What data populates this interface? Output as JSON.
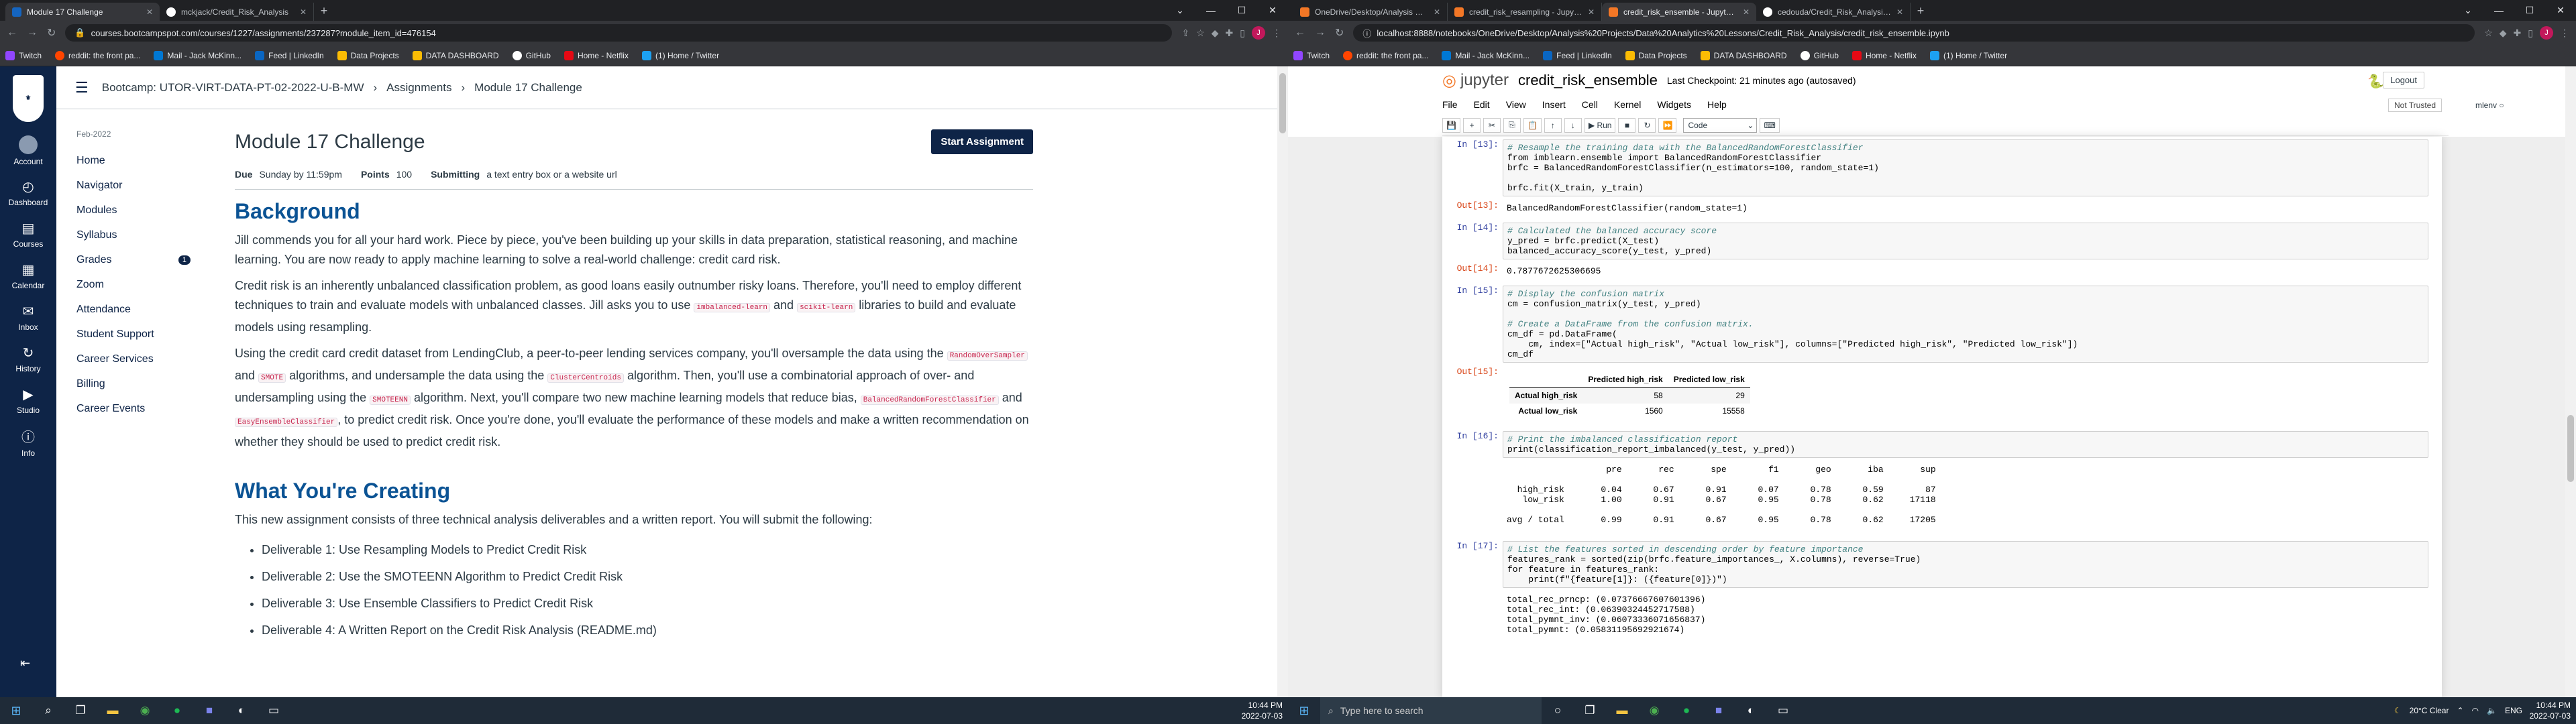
{
  "left": {
    "tabs": [
      {
        "title": "Module 17 Challenge",
        "active": true,
        "color": "#1565c0"
      },
      {
        "title": "mckjack/Credit_Risk_Analysis",
        "active": false,
        "color": "#ffffff"
      }
    ],
    "url": "courses.bootcampspot.com/courses/1227/assignments/237287?module_item_id=476154",
    "bookmarks": [
      "Twitch",
      "reddit: the front pa...",
      "Mail - Jack McKinn...",
      "Feed | LinkedIn",
      "Data Projects",
      "DATA DASHBOARD",
      "GitHub",
      "Home - Netflix",
      "(1) Home / Twitter"
    ],
    "global_nav": [
      {
        "label": "Account",
        "icon": "●",
        "selected": false
      },
      {
        "label": "Dashboard",
        "icon": "◴",
        "selected": false
      },
      {
        "label": "Courses",
        "icon": "▤",
        "selected": false
      },
      {
        "label": "Calendar",
        "icon": "▦",
        "selected": false
      },
      {
        "label": "Inbox",
        "icon": "✉",
        "selected": false
      },
      {
        "label": "History",
        "icon": "↻",
        "selected": false
      },
      {
        "label": "Studio",
        "icon": "▶",
        "selected": false
      },
      {
        "label": "Info",
        "icon": "ⓘ",
        "selected": false
      }
    ],
    "breadcrumb": [
      "Bootcamp: UTOR-VIRT-DATA-PT-02-2022-U-B-MW",
      "Assignments",
      "Module 17 Challenge"
    ],
    "course_term": "Feb-2022",
    "course_nav": [
      {
        "label": "Home",
        "badge": ""
      },
      {
        "label": "Navigator",
        "badge": ""
      },
      {
        "label": "Modules",
        "badge": ""
      },
      {
        "label": "Syllabus",
        "badge": ""
      },
      {
        "label": "Grades",
        "badge": "1"
      },
      {
        "label": "Zoom",
        "badge": ""
      },
      {
        "label": "Attendance",
        "badge": ""
      },
      {
        "label": "Student Support",
        "badge": ""
      },
      {
        "label": "Career Services",
        "badge": ""
      },
      {
        "label": "Billing",
        "badge": ""
      },
      {
        "label": "Career Events",
        "badge": ""
      }
    ],
    "page_title": "Module 17 Challenge",
    "start_button": "Start Assignment",
    "meta": {
      "due_label": "Due",
      "due_value": "Sunday by 11:59pm",
      "points_label": "Points",
      "points_value": "100",
      "submitting_label": "Submitting",
      "submitting_value": "a text entry box or a website url"
    },
    "section1_title": "Background",
    "p1": "Jill commends you for all your hard work. Piece by piece, you've been building up your skills in data preparation, statistical reasoning, and machine learning. You are now ready to apply machine learning to solve a real-world challenge: credit card risk.",
    "p2a": "Credit risk is an inherently unbalanced classification problem, as good loans easily outnumber risky loans. Therefore, you'll need to employ different techniques to train and evaluate models with unbalanced classes. Jill asks you to use ",
    "p2_code1": "imbalanced-learn",
    "p2b": " and ",
    "p2_code2": "scikit-learn",
    "p2c": " libraries to build and evaluate models using resampling.",
    "p3a": "Using the credit card credit dataset from LendingClub, a peer-to-peer lending services company, you'll oversample the data using the ",
    "p3_code1": "RandomOverSampler",
    "p3b": " and ",
    "p3_code2": "SMOTE",
    "p3c": " algorithms, and undersample the data using the ",
    "p3_code3": "ClusterCentroids",
    "p3d": " algorithm. Then, you'll use a combinatorial approach of over- and undersampling using the ",
    "p3_code4": "SMOTEENN",
    "p3e": " algorithm. Next, you'll compare two new machine learning models that reduce bias, ",
    "p3_code5": "BalancedRandomForestClassifier",
    "p3f": " and ",
    "p3_code6": "EasyEnsembleClassifier",
    "p3g": ", to predict credit risk. Once you're done, you'll evaluate the performance of these models and make a written recommendation on whether they should be used to predict credit risk.",
    "section2_title": "What You're Creating",
    "p4": "This new assignment consists of three technical analysis deliverables and a written report. You will submit the following:",
    "deliverables": [
      "Deliverable 1: Use Resampling Models to Predict Credit Risk",
      "Deliverable 2: Use the SMOTEENN Algorithm to Predict Credit Risk",
      "Deliverable 3: Use Ensemble Classifiers to Predict Credit Risk",
      "Deliverable 4: A Written Report on the Credit Risk Analysis (README.md)"
    ],
    "taskbar": {
      "search_placeholder": "Type here to search",
      "time": "10:44 PM",
      "date": "2022-07-03"
    }
  },
  "right": {
    "tabs": [
      {
        "title": "OneDrive/Desktop/Analysis Proj...",
        "active": false,
        "color": "#f37726"
      },
      {
        "title": "credit_risk_resampling - Jupyter N...",
        "active": false,
        "color": "#f37726"
      },
      {
        "title": "credit_risk_ensemble - Jupyter N...",
        "active": true,
        "color": "#f37726"
      },
      {
        "title": "cedouda/Credit_Risk_Analysis: Bu...",
        "active": false,
        "color": "#ffffff"
      }
    ],
    "url": "localhost:8888/notebooks/OneDrive/Desktop/Analysis%20Projects/Data%20Analytics%20Lessons/Credit_Risk_Analysis/credit_risk_ensemble.ipynb",
    "jupyter_label": "jupyter",
    "notebook_name": "credit_risk_ensemble",
    "checkpoint": "Last Checkpoint: 21 minutes ago  (autosaved)",
    "logout": "Logout",
    "menu": [
      "File",
      "Edit",
      "View",
      "Insert",
      "Cell",
      "Kernel",
      "Widgets",
      "Help"
    ],
    "trusted": "Not Trusted",
    "kernel": "mlenv",
    "run_label": "Run",
    "cell_type": "Code",
    "prompts": {
      "in13": "In [13]:",
      "out13": "Out[13]:",
      "in14": "In [14]:",
      "out14": "Out[14]:",
      "in15": "In [15]:",
      "out15": "Out[15]:",
      "in16": "In [16]:",
      "in17": "In [17]:"
    },
    "cells": {
      "c13_l1": "# Resample the training data with the BalancedRandomForestClassifier",
      "c13_l2": "from imblearn.ensemble import BalancedRandomForestClassifier",
      "c13_l3": "brfc = BalancedRandomForestClassifier(n_estimators=100, random_state=1)",
      "c13_l4": "brfc.fit(X_train, y_train)",
      "o13": "BalancedRandomForestClassifier(random_state=1)",
      "c14_l1": "# Calculated the balanced accuracy score",
      "c14_l2": "y_pred = brfc.predict(X_test)",
      "c14_l3": "balanced_accuracy_score(y_test, y_pred)",
      "o14": "0.7877672625306695",
      "c15_l1": "# Display the confusion matrix",
      "c15_l2": "cm = confusion_matrix(y_test, y_pred)",
      "c15_l3": "# Create a DataFrame from the confusion matrix.",
      "c15_l4": "cm_df = pd.DataFrame(",
      "c15_l5": "    cm, index=[\"Actual high_risk\", \"Actual low_risk\"], columns=[\"Predicted high_risk\", \"Predicted low_risk\"])",
      "c15_l6": "cm_df",
      "c16_l1": "# Print the imbalanced classification report",
      "c16_l2": "print(classification_report_imbalanced(y_test, y_pred))",
      "report": "                   pre       rec       spe        f1       geo       iba       sup\n\n  high_risk       0.04      0.67      0.91      0.07      0.78      0.59        87\n   low_risk       1.00      0.91      0.67      0.95      0.78      0.62     17118\n\navg / total       0.99      0.91      0.67      0.95      0.78      0.62     17205",
      "c17_l1": "# List the features sorted in descending order by feature importance",
      "c17_l2": "features_rank = sorted(zip(brfc.feature_importances_, X.columns), reverse=True)",
      "c17_l3": "for feature in features_rank:",
      "c17_l4": "    print(f\"{feature[1]}: ({feature[0]})\")",
      "o17": "total_rec_prncp: (0.07376667607601396)\ntotal_rec_int: (0.06390324452717588)\ntotal_pymnt_inv: (0.06073336071656837)\ntotal_pymnt: (0.05831195692921674)"
    },
    "cm_table": {
      "columns": [
        "",
        "Predicted high_risk",
        "Predicted low_risk"
      ],
      "rows": [
        [
          "Actual high_risk",
          "58",
          "29"
        ],
        [
          "Actual low_risk",
          "1560",
          "15558"
        ]
      ]
    },
    "taskbar": {
      "search_placeholder": "Type here to search",
      "weather": "20°C  Clear",
      "lang": "ENG",
      "time": "10:44 PM",
      "date": "2022-07-03"
    }
  }
}
